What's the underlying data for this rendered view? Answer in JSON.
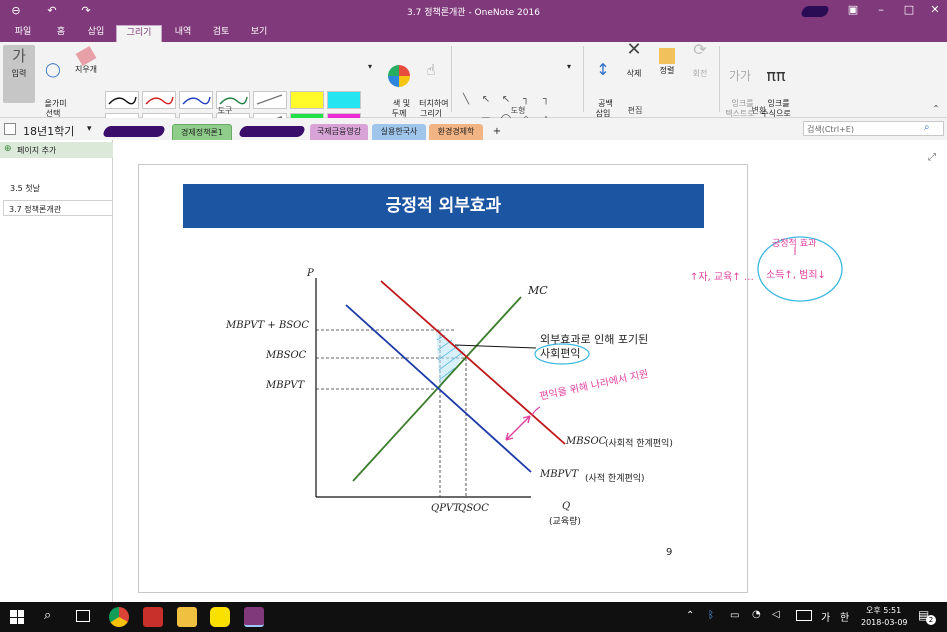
{
  "window": {
    "title": "3.7 정책론개관 - OneNote 2016"
  },
  "tabs": [
    "파일",
    "홈",
    "삽입",
    "그리기",
    "내역",
    "검토",
    "보기"
  ],
  "ribbon": {
    "input_label": "입력",
    "lasso_label": "올가미\n선택",
    "eraser_label": "지우개",
    "color_label": "색 및\n두께",
    "touch_label": "터치하여\n그리기",
    "space_label": "공백\n삽입",
    "delete_label": "삭제",
    "arrange_label": "정렬",
    "rotate_label": "회전",
    "ink_text_label": "잉크를\n텍스트로",
    "ink_math_label": "잉크를\n수식으로",
    "groups": {
      "tools": "도구",
      "shapes": "도형",
      "edit": "편집",
      "convert": "변환"
    }
  },
  "notebook": {
    "name": "18년1학기",
    "search_placeholder": "검색(Ctrl+E)"
  },
  "section_tabs": [
    {
      "label": "경제정책론1",
      "color": "#8fce8a"
    },
    {
      "label": "국제금융영강",
      "color": "#d8a4d8"
    },
    {
      "label": "실용한국사",
      "color": "#9fc6ea"
    },
    {
      "label": "환경경제학",
      "color": "#f2b483"
    },
    {
      "label": "+",
      "color": "#f3f3f3"
    }
  ],
  "sidebar": {
    "add_page": "페이지 추가",
    "pages": [
      "3.5 첫날",
      "3.7 정책론개관"
    ]
  },
  "slide": {
    "title": "긍정적 외부효과",
    "page_number": "9",
    "axis_p": "P",
    "axis_q": "Q",
    "axis_q_unit": "(교육량)",
    "label_mc": "MC",
    "label_mbpvt_bsoc": "MBPVT + BSOC",
    "label_mbsoc": "MBSOC",
    "label_mbpvt": "MBPVT",
    "label_qpvt": "QPVT",
    "label_qsoc": "QSOC",
    "label_mbsoc_line": "MBSOC",
    "label_mbsoc_desc": "(사회적 한계편익)",
    "label_mbpvt_line": "MBPVT",
    "label_mbpvt_desc": "(사적 한계편익)",
    "annotation_1": "외부효과로 인해 포기된",
    "annotation_2": "사회편익",
    "handwriting_1": "편익을 위해 나라에서 지원",
    "handwriting_2": "긍정적 효과",
    "handwriting_3": "소득↑, 범죄↓",
    "handwriting_4": "↑자, 교육↑ …"
  },
  "taskbar": {
    "ime": "가",
    "ime2": "한",
    "time": "오후 5:51",
    "date": "2018-03-09",
    "notif": "2"
  },
  "colors": {
    "onenote_purple": "#80397b",
    "slide_header": "#1c56a3",
    "mc": "#3a7d2c",
    "mbsoc": "#c0171b",
    "mbpvt": "#1c3aa8",
    "handwriting": "#e2409e"
  }
}
